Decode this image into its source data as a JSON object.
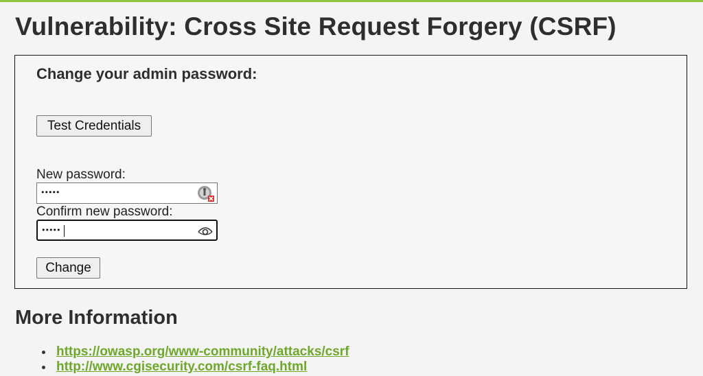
{
  "page": {
    "title": "Vulnerability: Cross Site Request Forgery (CSRF)"
  },
  "form": {
    "heading": "Change your admin password:",
    "test_button_label": "Test Credentials",
    "new_password_label": "New password:",
    "new_password_masked": "•••••",
    "confirm_password_label": "Confirm new password:",
    "confirm_password_masked": "•••••",
    "change_button_label": "Change"
  },
  "more_info": {
    "heading": "More Information",
    "links": [
      {
        "label": "https://owasp.org/www-community/attacks/csrf"
      },
      {
        "label": "http://www.cgisecurity.com/csrf-faq.html"
      }
    ]
  },
  "icons": {
    "new_password_field_icon": "password-manager-warning-icon",
    "confirm_password_field_icon": "eye-icon"
  },
  "colors": {
    "accent_bar": "#8cc63f",
    "link": "#6ea82a",
    "warning_badge": "#d9302c"
  }
}
